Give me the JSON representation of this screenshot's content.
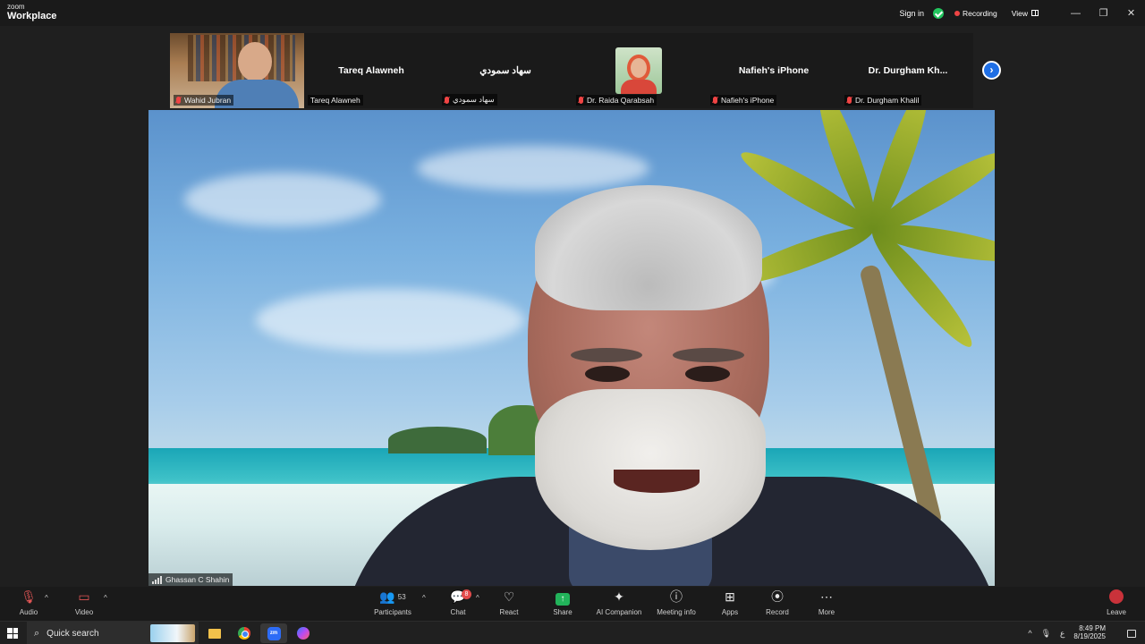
{
  "window": {
    "brand_small": "zoom",
    "brand": "Workplace",
    "sign_in": "Sign in",
    "recording": "Recording",
    "view": "View",
    "minimize": "—",
    "maximize": "❐",
    "close": "✕"
  },
  "participants_strip": {
    "tiles": [
      {
        "display_name": "",
        "label": "Wahid Jubran",
        "muted": true,
        "has_video": true
      },
      {
        "display_name": "Tareq Alawneh",
        "label": "Tareq Alawneh",
        "muted": false,
        "has_video": false
      },
      {
        "display_name": "سهاد سمودي",
        "label": "سهاد سمودي",
        "muted": true,
        "has_video": false
      },
      {
        "display_name": "",
        "label": "Dr. Raida Qarabsah",
        "muted": true,
        "has_video": true
      },
      {
        "display_name": "Nafieh's iPhone",
        "label": "Nafieh's iPhone",
        "muted": true,
        "has_video": false
      },
      {
        "display_name": "Dr. Durgham Kh...",
        "label": "Dr. Durgham Khalil",
        "muted": true,
        "has_video": false
      }
    ],
    "next_icon": "›"
  },
  "speaker": {
    "name": "Ghassan C Shahin"
  },
  "toolbar": {
    "audio": "Audio",
    "video": "Video",
    "participants": "Participants",
    "participants_count": "53",
    "chat": "Chat",
    "chat_badge": "8",
    "react": "React",
    "share": "Share",
    "ai_companion": "AI Companion",
    "meeting_info": "Meeting info",
    "apps": "Apps",
    "record": "Record",
    "more": "More",
    "leave": "Leave"
  },
  "taskbar": {
    "search": "Quick search",
    "zoom_app": "zm",
    "lang": "ع",
    "time": "8:49 PM",
    "date": "8/19/2025"
  },
  "colors": {
    "recording_dot": "#ef4444",
    "verified": "#22c55e",
    "accent": "#1f6fe5",
    "share": "#22b35a",
    "leave": "#c9323a"
  }
}
